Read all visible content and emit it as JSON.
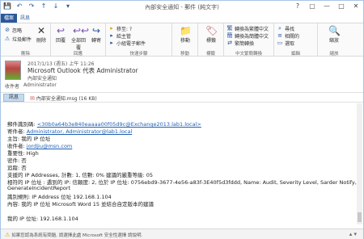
{
  "window": {
    "title": "內部安全通知 - 郵件 (純文字)",
    "controls": {
      "help": "?",
      "restore": "▢",
      "minimize": "—",
      "maximize": "□",
      "close": "✕"
    }
  },
  "quick_access": {
    "save": "💾",
    "undo": "↶",
    "redo": "↷",
    "up": "↑",
    "down": "↓",
    "more": "▾"
  },
  "ribbon": {
    "file_tab": "檔案",
    "message_tab": "訊息",
    "groups": {
      "delete": {
        "label": "刪除",
        "buttons": {
          "ignore": "忽略",
          "junk": "垃圾郵件",
          "delete": "刪除"
        }
      },
      "respond": {
        "label": "回應",
        "buttons": {
          "reply": "回覆",
          "reply_all": "全部回覆",
          "forward": "轉寄"
        }
      },
      "quick_steps": {
        "label": "快速步驟",
        "items": [
          "移至: ?",
          "給主管",
          "小組電子郵件"
        ]
      },
      "move": {
        "label": "移動",
        "buttons": {
          "move": "移動"
        }
      },
      "tags": {
        "label": "標籤",
        "buttons": {
          "tags": "標籤"
        }
      },
      "translate": {
        "label": "中文繁簡轉換",
        "items": [
          "轉換為繁體中文",
          "轉換為簡體中文",
          "繁簡轉換"
        ]
      },
      "editing": {
        "label": "編輯",
        "items": [
          "尋找",
          "相關的",
          "選取"
        ]
      },
      "zoom": {
        "label": "縮放",
        "buttons": {
          "zoom": "縮放"
        }
      }
    }
  },
  "header": {
    "date": "2017/1/13 (週五) 上午 11:26",
    "sender": "Microsoft Outlook 代表 Administrator",
    "subject": "內部安全通知",
    "to_label": "收件者",
    "to_value": "Administrator"
  },
  "attach_bar": {
    "message_button": "訊息",
    "attachment": "內部安全通知.msg (16 KB)"
  },
  "body": {
    "lines": [
      {
        "label": "郵件識別碼: ",
        "value": "<30b0a64b3e840eaaaa00f05d9c@Exchange2013.lab1.local>"
      },
      {
        "label": "寄件者: ",
        "value": "Administrator, Administrator@lab1.local"
      },
      {
        "label": "主旨: ",
        "value": "我的 IP 位址"
      },
      {
        "label": "收件者: ",
        "value": "jordjiu@msn.com"
      },
      {
        "label": "重要性: ",
        "value": "High"
      },
      {
        "label": "密件: ",
        "value": "否"
      },
      {
        "label": "追蹤: ",
        "value": "否"
      },
      {
        "label": "",
        "value": "支援的 IP Addresses, 計數: 1, 信數: 0% 建議的嚴重等級: 05"
      },
      {
        "label": "",
        "value": "相符的 IP 位址 : 遇到的 IP: 信頼度: 2, 位於 IP 位址: 0756ebd9-3677-4e56-a83f-3E40f5d3fddd, Name: Audit, Severity Level, Sarder Notify,"
      },
      {
        "label": "",
        "value": "GenerateIncidentReport"
      },
      {
        "label": "",
        "value": "識別規則: IP Address 位址 192.168.1.104"
      },
      {
        "label": "",
        "value": "內容: 我的 IP 位址 Microsoft Word 15 並結合自定版本的建議"
      },
      {
        "label": "",
        "value": ""
      },
      {
        "label": "",
        "value": "我的 IP 位址: 192.168.1.104"
      }
    ]
  },
  "status": {
    "text": "如果您認為系統有問題, 請選擇此處 Microsoft 安全性選擇 請說明."
  },
  "colors": {
    "accent": "#2b579a",
    "link": "#1f5fb3"
  },
  "icons": {
    "ignore": "⊘",
    "junk": "⚠",
    "delete": "✕",
    "reply": "↩",
    "reply_all": "↩↩",
    "forward": "↪",
    "move": "📁",
    "tags": "🏷",
    "zoom": "🔍",
    "attachment": "✉",
    "warning": "⚠"
  }
}
